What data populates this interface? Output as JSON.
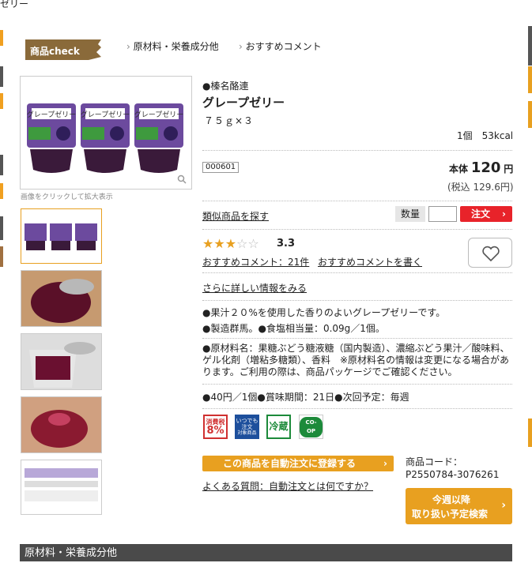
{
  "top_fragment": "ゼリー",
  "header": {
    "check_label": "商品check",
    "tabs": [
      "原材料・栄養成分他",
      "おすすめコメント"
    ]
  },
  "gallery": {
    "enlarge_hint": "画像をクリックして拡大表示",
    "zoom_icon": "magnifier-icon"
  },
  "product": {
    "maker": "●榛名酪連",
    "name": "グレープゼリー",
    "size": "７５ｇ×３",
    "calorie": "1個　53kcal",
    "code_box": "000601",
    "price_label": "本体",
    "price": "120",
    "price_unit": "円",
    "tax_price": "(税込 129.6円)",
    "similar_link": "類似商品を探す",
    "qty_label": "数量",
    "qty_value": "",
    "order_button": "注文",
    "rating_stars": 3,
    "rating_max": 5,
    "rating": "3.3",
    "comments_link": "おすすめコメント：21件",
    "write_comment_link": "おすすめコメントを書く",
    "more_info_link": "さらに詳しい情報をみる",
    "desc1": "●果汁２０%を使用した香りのよいグレープゼリーです。",
    "desc2": "●製造群馬。●食塩相当量：0.09g／1個。",
    "ingredients": "●原材料名：果糖ぶどう糖液糖（国内製造）、濃縮ぶどう果汁／酸味料、ゲル化剤（増粘多糖類）、香料　※原材料名の情報は変更になる場合があります。ご利用の際は、商品パッケージでご確認ください。",
    "delivery": "●40円／1個●賞味期間：21日●次回予定：毎週",
    "badges": {
      "tax": [
        "消費税",
        "8%"
      ],
      "always": [
        "いつでも",
        "注文",
        "対象商品"
      ],
      "cold": "冷蔵",
      "coop": "CO-OP"
    },
    "auto_order_button": "この商品を自動注文に登録する",
    "faq_link": "よくある質問：自動注文とは何ですか？",
    "product_code_label": "商品コード：",
    "product_code": "P2550784-3076261",
    "schedule_button": [
      "今週以降",
      "取り扱い予定検索"
    ]
  },
  "footer_section_title": "原材料・栄養成分他",
  "colors": {
    "accent_orange": "#e8a020",
    "order_red": "#e8232a",
    "check_brown": "#8a6a3a",
    "section_dark": "#4a4a4a",
    "cold_green": "#1c8a3a",
    "always_blue": "#1d4f9c"
  }
}
